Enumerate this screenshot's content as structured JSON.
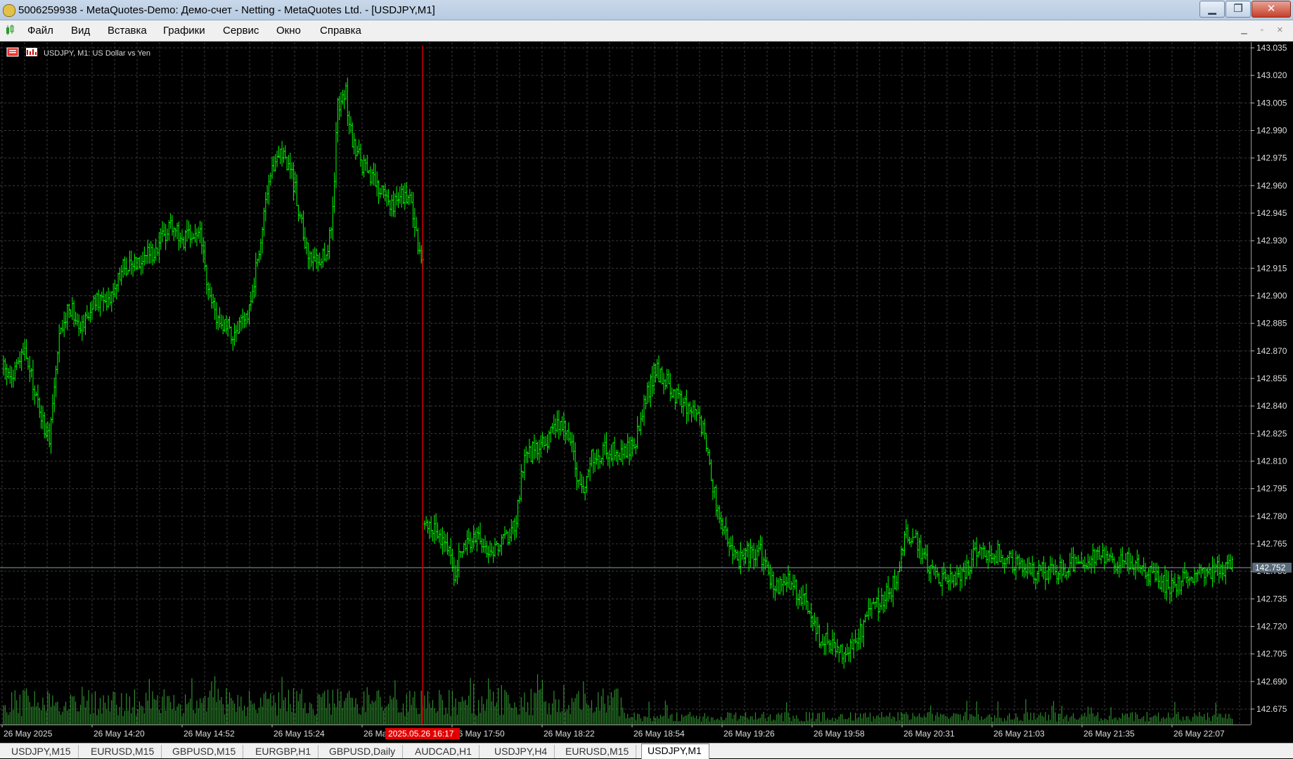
{
  "window": {
    "title": "5006259938 - MetaQuotes-Demo: Демо-счет - Netting - MetaQuotes Ltd. - [USDJPY,M1]",
    "min_glyph": "▁",
    "max_glyph": "❐",
    "close_glyph": "✕"
  },
  "menu": {
    "items": [
      "Файл",
      "Вид",
      "Вставка",
      "Графики",
      "Сервис",
      "Окно",
      "Справка"
    ],
    "mdi_controls": "▁ ▫ ✕"
  },
  "chart": {
    "header_label": "USDJPY, M1:  US Dollar vs Yen",
    "current_price_label": "142.752",
    "crosshair_time_label": "2025.05.26 16:17",
    "bull_color": "#00ff00",
    "bear_color": "#00ff00",
    "volume_color": "#2e8b2e",
    "grid_color": "#3a3a3a",
    "vline_color": "#cc0000"
  },
  "chart_data": {
    "type": "bar",
    "symbol": "USDJPY",
    "timeframe": "M1",
    "ylim": [
      142.66,
      143.04
    ],
    "y_ticks": [
      143.035,
      143.02,
      143.005,
      142.99,
      142.975,
      142.96,
      142.945,
      142.93,
      142.915,
      142.9,
      142.885,
      142.87,
      142.855,
      142.84,
      142.825,
      142.81,
      142.795,
      142.78,
      142.765,
      142.75,
      142.735,
      142.72,
      142.705,
      142.69,
      142.675
    ],
    "x_ticks": [
      "26 May 2025",
      "26 May 14:20",
      "26 May 14:52",
      "26 May 15:24",
      "26 May 15:56",
      "26 May 17:50",
      "26 May 18:22",
      "26 May 18:54",
      "26 May 19:26",
      "26 May 19:58",
      "26 May 20:31",
      "26 May 21:03",
      "26 May 21:35",
      "26 May 22:07"
    ],
    "close_path_anchors": [
      [
        0,
        142.86
      ],
      [
        10,
        142.855
      ],
      [
        25,
        142.87
      ],
      [
        40,
        142.845
      ],
      [
        55,
        142.82
      ],
      [
        68,
        142.875
      ],
      [
        80,
        142.895
      ],
      [
        95,
        142.885
      ],
      [
        110,
        142.895
      ],
      [
        130,
        142.9
      ],
      [
        145,
        142.915
      ],
      [
        165,
        142.92
      ],
      [
        185,
        142.925
      ],
      [
        205,
        142.94
      ],
      [
        220,
        142.93
      ],
      [
        240,
        142.935
      ],
      [
        250,
        142.9
      ],
      [
        265,
        142.885
      ],
      [
        280,
        142.88
      ],
      [
        295,
        142.885
      ],
      [
        305,
        142.905
      ],
      [
        315,
        142.935
      ],
      [
        325,
        142.96
      ],
      [
        335,
        142.98
      ],
      [
        345,
        142.975
      ],
      [
        355,
        142.96
      ],
      [
        365,
        142.935
      ],
      [
        372,
        142.92
      ],
      [
        385,
        142.92
      ],
      [
        395,
        142.925
      ],
      [
        402,
        142.945
      ],
      [
        408,
        143.005
      ],
      [
        418,
        143.01
      ],
      [
        425,
        142.985
      ],
      [
        435,
        142.975
      ],
      [
        445,
        142.965
      ],
      [
        455,
        142.96
      ],
      [
        465,
        142.955
      ],
      [
        475,
        142.95
      ],
      [
        485,
        142.955
      ],
      [
        495,
        142.955
      ],
      [
        505,
        142.93
      ],
      [
        512,
        142.915
      ],
      [
        513,
        142.78
      ],
      [
        525,
        142.775
      ],
      [
        540,
        142.765
      ],
      [
        550,
        142.75
      ],
      [
        565,
        142.765
      ],
      [
        580,
        142.77
      ],
      [
        595,
        142.76
      ],
      [
        610,
        142.765
      ],
      [
        625,
        142.775
      ],
      [
        635,
        142.81
      ],
      [
        645,
        142.815
      ],
      [
        660,
        142.82
      ],
      [
        675,
        142.83
      ],
      [
        685,
        142.83
      ],
      [
        695,
        142.815
      ],
      [
        705,
        142.79
      ],
      [
        715,
        142.81
      ],
      [
        730,
        142.815
      ],
      [
        745,
        142.815
      ],
      [
        760,
        142.815
      ],
      [
        775,
        142.825
      ],
      [
        785,
        142.845
      ],
      [
        795,
        142.86
      ],
      [
        805,
        142.855
      ],
      [
        815,
        142.85
      ],
      [
        830,
        142.84
      ],
      [
        845,
        142.84
      ],
      [
        855,
        142.825
      ],
      [
        865,
        142.8
      ],
      [
        875,
        142.775
      ],
      [
        885,
        142.765
      ],
      [
        895,
        142.755
      ],
      [
        905,
        142.76
      ],
      [
        915,
        142.76
      ],
      [
        925,
        142.76
      ],
      [
        935,
        142.745
      ],
      [
        945,
        142.74
      ],
      [
        960,
        142.745
      ],
      [
        975,
        142.735
      ],
      [
        985,
        142.73
      ],
      [
        995,
        142.715
      ],
      [
        1010,
        142.71
      ],
      [
        1020,
        142.705
      ],
      [
        1035,
        142.71
      ],
      [
        1045,
        142.715
      ],
      [
        1060,
        142.73
      ],
      [
        1075,
        142.735
      ],
      [
        1090,
        142.745
      ],
      [
        1100,
        142.77
      ],
      [
        1110,
        142.77
      ],
      [
        1120,
        142.76
      ],
      [
        1130,
        142.75
      ],
      [
        1145,
        142.745
      ],
      [
        1160,
        142.745
      ],
      [
        1175,
        142.75
      ],
      [
        1185,
        142.76
      ],
      [
        1200,
        142.76
      ],
      [
        1215,
        142.76
      ],
      [
        1230,
        142.755
      ],
      [
        1245,
        142.755
      ],
      [
        1260,
        142.75
      ],
      [
        1275,
        142.75
      ],
      [
        1290,
        142.75
      ],
      [
        1305,
        142.755
      ],
      [
        1320,
        142.755
      ],
      [
        1335,
        142.76
      ],
      [
        1350,
        142.755
      ],
      [
        1365,
        142.755
      ],
      [
        1380,
        142.755
      ],
      [
        1395,
        142.75
      ],
      [
        1410,
        142.745
      ],
      [
        1425,
        142.74
      ],
      [
        1440,
        142.745
      ],
      [
        1455,
        142.75
      ],
      [
        1470,
        142.75
      ],
      [
        1485,
        142.752
      ],
      [
        1500,
        142.752
      ]
    ]
  },
  "tabs": [
    "USDJPY,M15",
    "EURUSD,M15",
    "GBPUSD,M15",
    "EURGBP,H1",
    "GBPUSD,Daily",
    "AUDCAD,H1",
    "USDJPY,H4",
    "EURUSD,M15",
    "USDJPY,M1"
  ],
  "active_tab_index": 8
}
